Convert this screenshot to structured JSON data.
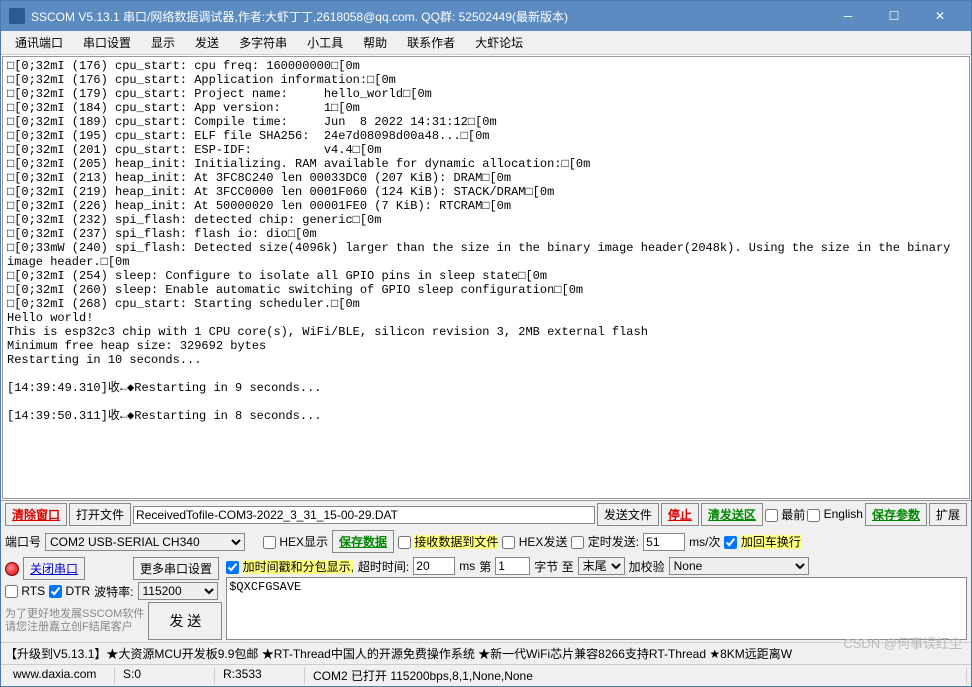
{
  "titlebar": {
    "title": "SSCOM V5.13.1 串口/网络数据调试器,作者:大虾丁丁,2618058@qq.com. QQ群:  52502449(最新版本)"
  },
  "menu": {
    "items": [
      "通讯端口",
      "串口设置",
      "显示",
      "发送",
      "多字符串",
      "小工具",
      "帮助",
      "联系作者",
      "大虾论坛"
    ]
  },
  "output": "□[0;32mI (176) cpu_start: cpu freq: 160000000□[0m\n□[0;32mI (176) cpu_start: Application information:□[0m\n□[0;32mI (179) cpu_start: Project name:     hello_world□[0m\n□[0;32mI (184) cpu_start: App version:      1□[0m\n□[0;32mI (189) cpu_start: Compile time:     Jun  8 2022 14:31:12□[0m\n□[0;32mI (195) cpu_start: ELF file SHA256:  24e7d08098d00a48...□[0m\n□[0;32mI (201) cpu_start: ESP-IDF:          v4.4□[0m\n□[0;32mI (205) heap_init: Initializing. RAM available for dynamic allocation:□[0m\n□[0;32mI (213) heap_init: At 3FC8C240 len 00033DC0 (207 KiB): DRAM□[0m\n□[0;32mI (219) heap_init: At 3FCC0000 len 0001F060 (124 KiB): STACK/DRAM□[0m\n□[0;32mI (226) heap_init: At 50000020 len 00001FE0 (7 KiB): RTCRAM□[0m\n□[0;32mI (232) spi_flash: detected chip: generic□[0m\n□[0;32mI (237) spi_flash: flash io: dio□[0m\n□[0;33mW (240) spi_flash: Detected size(4096k) larger than the size in the binary image header(2048k). Using the size in the binary image header.□[0m\n□[0;32mI (254) sleep: Configure to isolate all GPIO pins in sleep state□[0m\n□[0;32mI (260) sleep: Enable automatic switching of GPIO sleep configuration□[0m\n□[0;32mI (268) cpu_start: Starting scheduler.□[0m\nHello world!\nThis is esp32c3 chip with 1 CPU core(s), WiFi/BLE, silicon revision 3, 2MB external flash\nMinimum free heap size: 329692 bytes\nRestarting in 10 seconds...\n\n[14:39:49.310]收←◆Restarting in 9 seconds...\n\n[14:39:50.311]收←◆Restarting in 8 seconds...\n",
  "toolbar1": {
    "clear_window": "清除窗口",
    "open_file": "打开文件",
    "filepath": "ReceivedTofile-COM3-2022_3_31_15-00-29.DAT",
    "send_file": "发送文件",
    "stop": "停止",
    "clear_send": "清发送区",
    "newest": "最前",
    "english": "English",
    "save_params": "保存参数",
    "extend": "扩展"
  },
  "toolbar2": {
    "port_label": "端口号",
    "port_value": "COM2 USB-SERIAL CH340",
    "hex_display": "HEX显示",
    "save_data": "保存数据",
    "recv_to_file": "接收数据到文件",
    "hex_send": "HEX发送",
    "timed_send": "定时发送:",
    "timed_value": "51",
    "timed_unit": "ms/次",
    "add_crlf": "加回车换行"
  },
  "toolbar3": {
    "close_port": "关闭串口",
    "more_settings": "更多串口设置",
    "add_timestamp": "加时间戳和分包显示,",
    "timeout_label": "超时时间:",
    "timeout_value": "20",
    "timeout_unit": "ms",
    "nth_label": "第",
    "nth_value": "1",
    "byte_label": "字节 至",
    "end_value": "末尾",
    "add_check": "加校验",
    "check_type": "None",
    "rts": "RTS",
    "dtr": "DTR",
    "baud_label": "波特率:",
    "baud_value": "115200",
    "help_line1": "为了更好地发展SSCOM软件",
    "help_line2": "请您注册嘉立创F结尾客户",
    "send_btn": "发  送",
    "send_text": "$QXCFGSAVE"
  },
  "promo": "【升级到V5.13.1】★大资源MCU开发板9.9包邮 ★RT-Thread中国人的开源免费操作系统 ★新一代WiFi芯片兼容8266支持RT-Thread ★8KM远距离W",
  "statusbar": {
    "site": "www.daxia.com",
    "s": "S:0",
    "r": "R:3533",
    "conn": "COM2 已打开 115200bps,8,1,None,None"
  },
  "watermark": "CSDN @何事误红尘"
}
